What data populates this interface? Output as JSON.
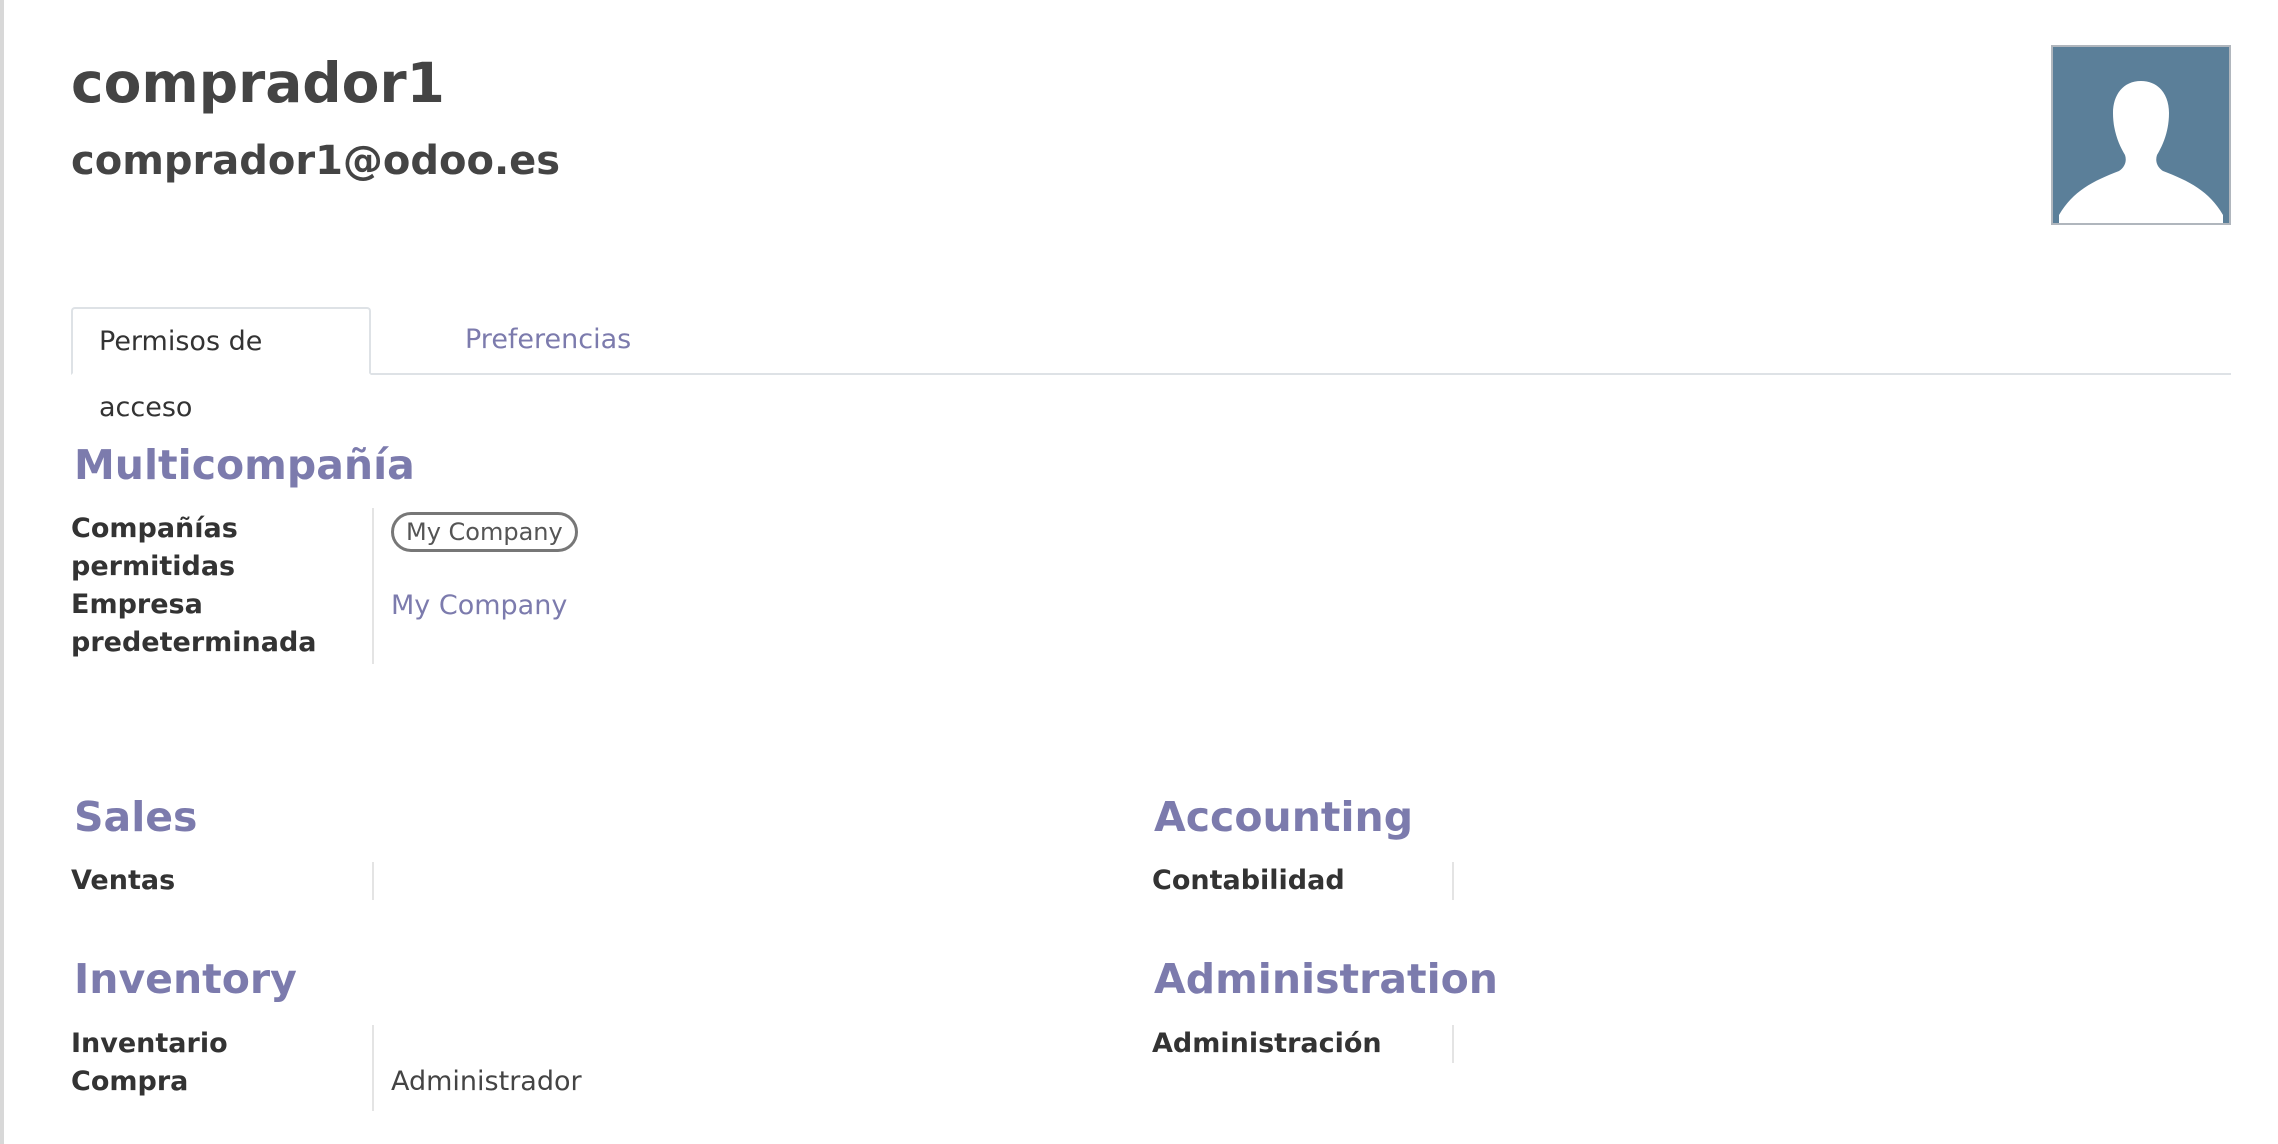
{
  "user": {
    "name": "comprador1",
    "email": "comprador1@odoo.es"
  },
  "tabs": [
    {
      "label": "Permisos de acceso",
      "active": true
    },
    {
      "label": "Preferencias",
      "active": false
    }
  ],
  "sections": {
    "multicompany": {
      "title": "Multicompañía",
      "allowed_companies_label_1": "Compañías",
      "allowed_companies_label_2": "permitidas",
      "allowed_companies_tags": [
        "My Company"
      ],
      "default_company_label_1": "Empresa",
      "default_company_label_2": "predeterminada",
      "default_company_value": "My Company"
    },
    "sales": {
      "title": "Sales",
      "field_label": "Ventas",
      "field_value": ""
    },
    "accounting": {
      "title": "Accounting",
      "field_label": "Contabilidad",
      "field_value": ""
    },
    "inventory": {
      "title": "Inventory",
      "field1_label": "Inventario",
      "field1_value": "",
      "field2_label": "Compra",
      "field2_value": "Administrador"
    },
    "administration": {
      "title": "Administration",
      "field_label": "Administración",
      "field_value": ""
    }
  },
  "colors": {
    "accent": "#7c7bad",
    "avatar_bg": "#5b7f99",
    "text_dark": "#444444"
  },
  "icons": {
    "avatar": "user-silhouette-icon"
  }
}
